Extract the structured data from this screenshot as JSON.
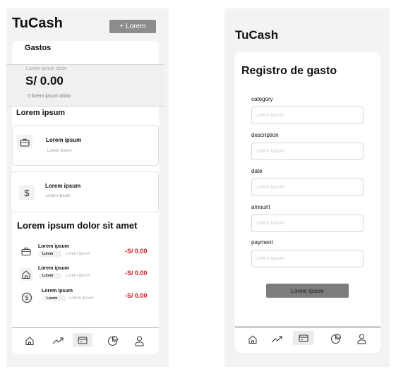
{
  "left": {
    "app_title": "TuCash",
    "add_button_label": "+ Lorem",
    "tab_label": "Gastos",
    "balance": {
      "caption": "Lorem ipsum dolor",
      "amount": "S/ 0.00",
      "subcaption": "0 lorem ipsum dolor"
    },
    "section_title": "Lorem ipsum",
    "categories": [
      {
        "icon": "briefcase-icon",
        "title": "Lorem ipsum",
        "subtitle": "Lorem ipsum"
      },
      {
        "icon": "dollar-icon",
        "title": "Lorem ipsum",
        "subtitle": "Lorem ipsum"
      }
    ],
    "list_title": "Lorem ipsum dolor sit amet",
    "transactions": [
      {
        "icon": "briefcase-icon",
        "title": "Lorem ipsum",
        "tag": "Lorem",
        "subtitle": "Lorem ipsum",
        "amount": "-S/ 0.00"
      },
      {
        "icon": "home-icon",
        "title": "Lorem ipsum",
        "tag": "Lorem",
        "subtitle": "Lorem ipsum",
        "amount": "-S/ 0.00"
      },
      {
        "icon": "dollar-circle-icon",
        "title": "Lorem ipsum",
        "tag": "Lorem",
        "subtitle": "Lorem ipsum",
        "amount": "-S/ 0.00"
      }
    ]
  },
  "right": {
    "app_title": "TuCash",
    "form_title": "Registro de gasto",
    "fields": [
      {
        "label": "category",
        "placeholder": "Lorem ipsum"
      },
      {
        "label": "description",
        "placeholder": "Lorem ipsum"
      },
      {
        "label": "date",
        "placeholder": "Lorem ipsum"
      },
      {
        "label": "amount",
        "placeholder": "Lorem ipsum"
      },
      {
        "label": "payment",
        "placeholder": "Lorem ipsum"
      }
    ],
    "submit_label": "Lorem ipsum"
  },
  "nav": [
    "home-icon",
    "trending-icon",
    "wallet-icon",
    "chart-icon",
    "user-icon"
  ],
  "colors": {
    "negative_amount": "#e0141e",
    "primary_button": "#7d7d7d",
    "nav_active": "#ececec"
  }
}
